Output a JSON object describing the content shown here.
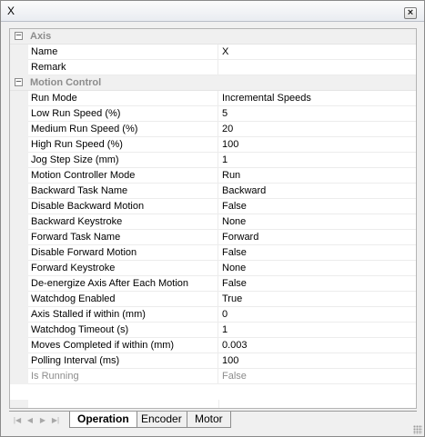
{
  "window": {
    "title": "X"
  },
  "icons": {
    "close": "close-icon",
    "expand": "collapse-icon",
    "nav": [
      "first-icon",
      "prev-icon",
      "next-icon",
      "last-icon"
    ]
  },
  "categories": [
    {
      "label": "Axis",
      "properties": [
        {
          "name": "Name",
          "value": "X"
        },
        {
          "name": "Remark",
          "value": ""
        }
      ]
    },
    {
      "label": "Motion Control",
      "properties": [
        {
          "name": "Run Mode",
          "value": "Incremental Speeds"
        },
        {
          "name": "Low Run Speed (%)",
          "value": "5"
        },
        {
          "name": "Medium Run Speed (%)",
          "value": "20"
        },
        {
          "name": "High Run Speed (%)",
          "value": "100"
        },
        {
          "name": "Jog Step Size (mm)",
          "value": "1"
        },
        {
          "name": "Motion Controller Mode",
          "value": "Run"
        },
        {
          "name": "Backward Task Name",
          "value": "Backward"
        },
        {
          "name": "Disable Backward Motion",
          "value": "False"
        },
        {
          "name": "Backward Keystroke",
          "value": "None"
        },
        {
          "name": "Forward Task Name",
          "value": "Forward"
        },
        {
          "name": "Disable Forward Motion",
          "value": "False"
        },
        {
          "name": "Forward Keystroke",
          "value": "None"
        },
        {
          "name": "De-energize Axis After Each Motion",
          "value": "False"
        },
        {
          "name": "Watchdog Enabled",
          "value": "True"
        },
        {
          "name": "Axis Stalled if within (mm)",
          "value": "0"
        },
        {
          "name": "Watchdog Timeout (s)",
          "value": "1"
        },
        {
          "name": "Moves Completed if within (mm)",
          "value": "0.003"
        },
        {
          "name": "Polling Interval (ms)",
          "value": "100"
        },
        {
          "name": "Is Running",
          "value": "False",
          "readonly": true
        }
      ]
    }
  ],
  "tabs": [
    {
      "label": "Operation",
      "active": true
    },
    {
      "label": "Encoder",
      "active": false
    },
    {
      "label": "Motor",
      "active": false
    }
  ]
}
